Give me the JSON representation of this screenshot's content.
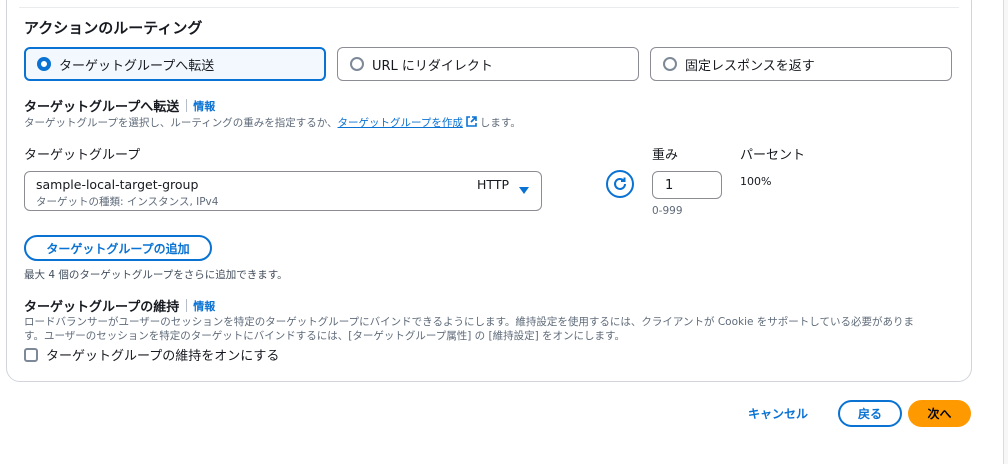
{
  "routing": {
    "title": "アクションのルーティング",
    "options": [
      {
        "label": "ターゲットグループへ転送",
        "selected": true
      },
      {
        "label": "URL にリダイレクト",
        "selected": false
      },
      {
        "label": "固定レスポンスを返す",
        "selected": false
      }
    ]
  },
  "forward": {
    "title": "ターゲットグループへ転送",
    "info": "情報",
    "desc_before": "ターゲットグループを選択し、ルーティングの重みを指定するか、",
    "desc_link": "ターゲットグループを作成",
    "desc_after": "します。"
  },
  "target_group": {
    "label": "ターゲットグループ",
    "selected_name": "sample-local-target-group",
    "protocol": "HTTP",
    "type_text": "ターゲットの種類: インスタンス, IPv4"
  },
  "weight": {
    "label": "重み",
    "value": "1",
    "range_hint": "0-999"
  },
  "percent": {
    "label": "パーセント",
    "value": "100%"
  },
  "add_button": {
    "label": "ターゲットグループの追加",
    "hint": "最大 4 個のターゲットグループをさらに追加できます。"
  },
  "stickiness": {
    "title": "ターゲットグループの維持",
    "info": "情報",
    "desc_line1": "ロードバランサーがユーザーのセッションを特定のターゲットグループにバインドできるようにします。維持設定を使用するには、クライアントが Cookie をサポートしている必要がありま",
    "desc_line2": "す。ユーザーのセッションを特定のターゲットにバインドするには、[ターゲットグループ属性] の [維持設定] をオンにします。",
    "checkbox_label": "ターゲットグループの維持をオンにする",
    "checked": false
  },
  "footer": {
    "cancel": "キャンセル",
    "back": "戻る",
    "next": "次へ"
  },
  "colors": {
    "accent": "#0972d3",
    "primary": "#ff9900"
  }
}
